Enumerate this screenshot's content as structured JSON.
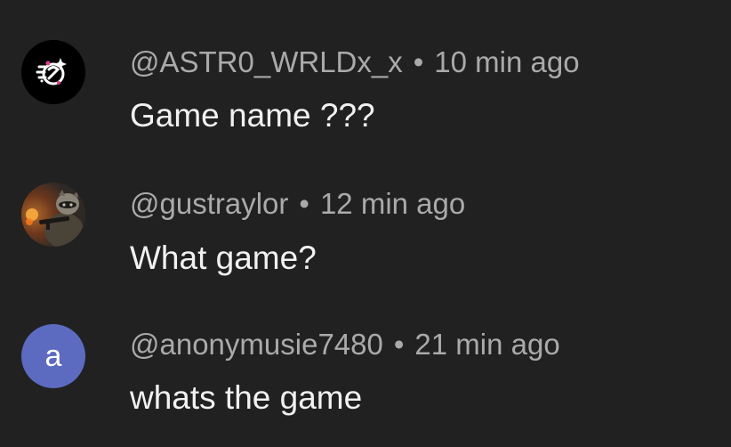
{
  "comments": [
    {
      "avatar": "astro-logo-icon",
      "handle": "@ASTR0_WRLDx_x",
      "separator": "•",
      "time": "10 min ago",
      "text": "Game name ???"
    },
    {
      "avatar": "raccoon-soldier-photo",
      "handle": "@gustraylor",
      "separator": "•",
      "time": "12 min ago",
      "text": "What game?"
    },
    {
      "avatar_letter": "a",
      "avatar_color": "#5c6bc0",
      "handle": "@anonymusie7480",
      "separator": "•",
      "time": "21 min ago",
      "text": "whats the game"
    }
  ],
  "colors": {
    "background": "#212121",
    "meta": "#aaaaaa",
    "text": "#f1f1f1"
  }
}
